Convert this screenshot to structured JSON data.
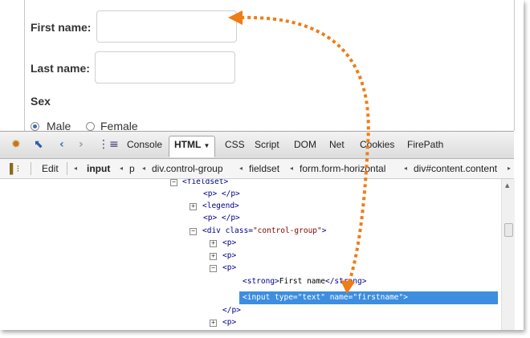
{
  "form": {
    "first_name_label": "First name:",
    "last_name_label": "Last name:",
    "sex_label": "Sex",
    "radio_male": "Male",
    "radio_female": "Female",
    "male_selected": true
  },
  "firebug": {
    "toolbar_tabs": [
      "Console",
      "HTML",
      "CSS",
      "Script",
      "DOM",
      "Net",
      "Cookies",
      "FirePath"
    ],
    "active_tab": "HTML",
    "html_dropdown_arrow": "▼",
    "icons": [
      "firebug-icon",
      "inspect-icon",
      "back-icon",
      "forward-icon",
      "command-line-icon"
    ],
    "edit_label": "Edit",
    "breadcrumbs": [
      "input",
      "p",
      "div.control-group",
      "fieldset",
      "form.form-horizontal",
      "div#content.content"
    ]
  },
  "tree": {
    "fieldset_open": "<fieldset>",
    "p_empty": "<p> </p>",
    "legend": "<legend>",
    "p_empty2": "<p> </p>",
    "div_open": "<div ",
    "div_attr": "class=",
    "div_val": "\"control-group\"",
    "div_close": ">",
    "p1": "<p>",
    "p2": "<p>",
    "p3": "<p>",
    "strong_open": "<strong>",
    "strong_text": "First name",
    "strong_close": "</strong>",
    "input_tag": "<input ",
    "input_attr1": "type=",
    "input_val1": "\"text\"",
    "input_attr2": " name=",
    "input_val2": "\"firstname\"",
    "input_close": ">",
    "p_close": "</p>",
    "p4": "<p>"
  },
  "colors": {
    "arrow": "#f07c15",
    "selection": "#3d8de0",
    "tag": "#000088",
    "value": "#880000"
  }
}
